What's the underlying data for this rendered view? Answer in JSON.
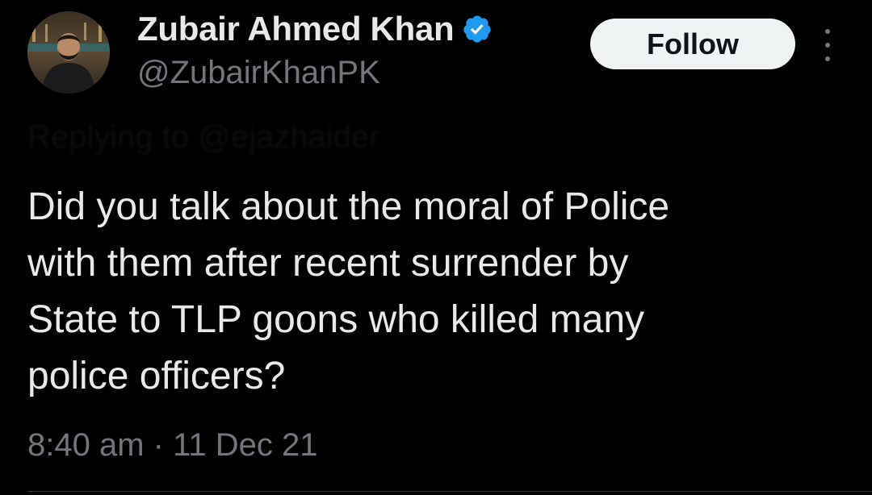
{
  "author": {
    "display_name": "Zubair Ahmed Khan",
    "handle": "@ZubairKhanPK",
    "verified": true,
    "avatar_icon": "profile-photo"
  },
  "actions": {
    "follow_label": "Follow",
    "more_icon": "more-vertical-icon"
  },
  "reply_context": "Replying to @ejazhaider",
  "tweet": {
    "text": "Did you talk about the moral of Police\nwith them after recent surrender by\nState to TLP goons who killed many\npolice officers?",
    "timestamp": "8:40 am · 11 Dec 21"
  },
  "colors": {
    "background": "#000000",
    "primary_text": "#e7e9ea",
    "secondary_text": "#71767b",
    "verified_blue": "#1d9bf0",
    "button_bg": "#eff3f4"
  }
}
